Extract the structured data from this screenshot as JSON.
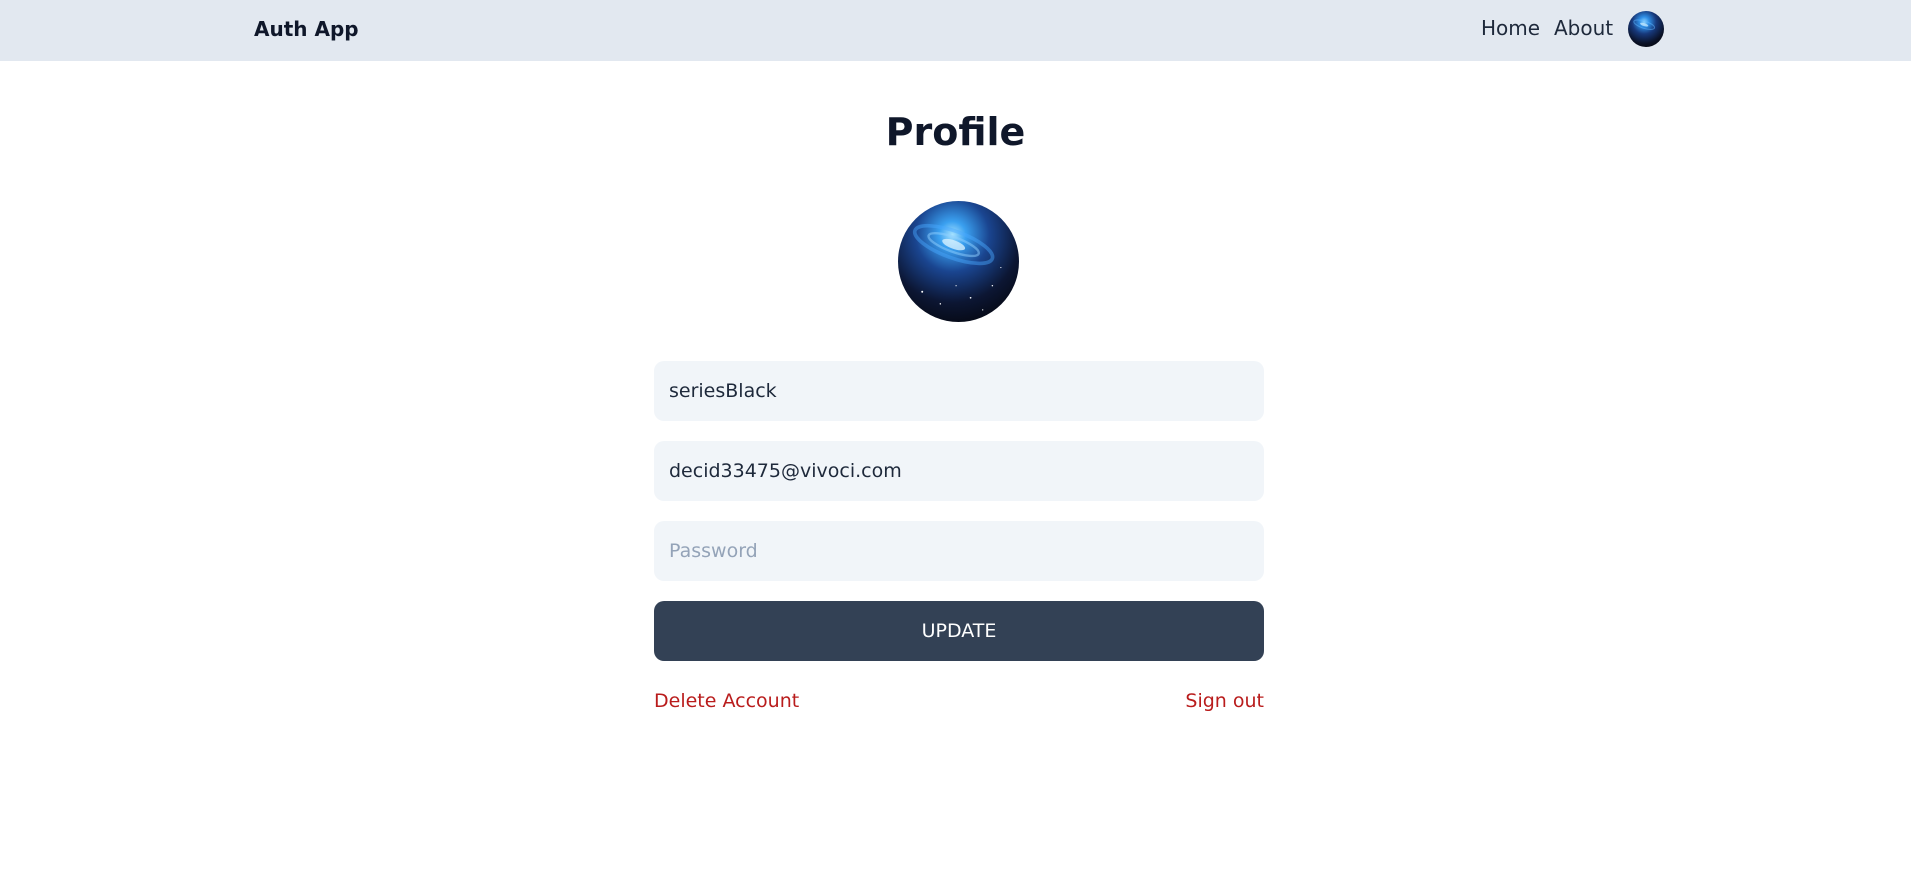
{
  "navbar": {
    "brand": "Auth App",
    "links": [
      {
        "label": "Home"
      },
      {
        "label": "About"
      }
    ]
  },
  "page": {
    "title": "Profile"
  },
  "form": {
    "username_value": "seriesBlack",
    "email_value": "decid33475@vivoci.com",
    "password_value": "",
    "password_placeholder": "Password",
    "update_label": "UPDATE"
  },
  "actions": {
    "delete_label": "Delete Account",
    "signout_label": "Sign out"
  },
  "colors": {
    "navbar_bg": "#e2e8f0",
    "field_bg": "#f1f5f9",
    "button_bg": "#334155",
    "danger": "#b91c1c"
  },
  "icons": {
    "avatar": "galaxy-avatar-image"
  }
}
